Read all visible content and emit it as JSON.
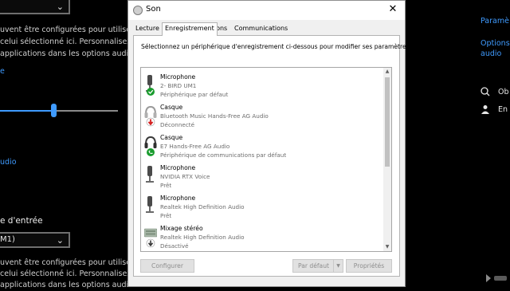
{
  "background": {
    "left": {
      "dropdown_top_value": "",
      "para1_lines": [
        "uvent être configurées pour utiliser d",
        "celui sélectionné ici. Personnalisez le",
        "applications dans les options audio a"
      ],
      "link1": "e",
      "link2": "udio",
      "heading_input": "e d'entrée",
      "dropdown_input_value": "M1)",
      "para2_lines": [
        "uvent être configurées pour utiliser d",
        "celui sélectionné ici. Personnalisez le",
        "applications dans les options audio a"
      ]
    },
    "right": {
      "link_params": "Paramè",
      "link_options_line1": "Options",
      "link_options_line2": "audio",
      "item1": "Ob",
      "item2": "En"
    }
  },
  "dialog": {
    "title": "Son",
    "tabs": [
      "Lecture",
      "Enregistrement",
      "Sons",
      "Communications"
    ],
    "active_tab": "Enregistrement",
    "instruction": "Sélectionnez un périphérique d'enregistrement ci-dessous pour modifier ses paramètres :",
    "devices": [
      {
        "name": "Microphone",
        "sub": "2- BIRD UM1",
        "status": "Périphérique par défaut",
        "icon": "microphone-icon",
        "badge": "default-check"
      },
      {
        "name": "Casque",
        "sub": "Bluetooth Music Hands-Free AG Audio",
        "status": "Déconnecté",
        "icon": "headset-icon",
        "badge": "disconnected-arrow"
      },
      {
        "name": "Casque",
        "sub": "E7 Hands-Free AG Audio",
        "status": "Périphérique de communications par défaut",
        "icon": "headset-icon",
        "badge": "comm-default-phone"
      },
      {
        "name": "Microphone",
        "sub": "NVIDIA RTX Voice",
        "status": "Prêt",
        "icon": "microphone-icon",
        "badge": ""
      },
      {
        "name": "Microphone",
        "sub": "Realtek High Definition Audio",
        "status": "Prêt",
        "icon": "microphone-icon",
        "badge": ""
      },
      {
        "name": "Mixage stéréo",
        "sub": "Realtek High Definition Audio",
        "status": "Désactivé",
        "icon": "stereo-mix-icon",
        "badge": "disabled-arrow"
      }
    ],
    "buttons": {
      "configure": "Configurer",
      "default": "Par défaut",
      "properties": "Propriétés"
    }
  },
  "colors": {
    "accent_blue": "#3f9bff",
    "check_green": "#1a9c2e",
    "disconnected_red": "#d42020",
    "dialog_bg": "#f0f0f0"
  }
}
